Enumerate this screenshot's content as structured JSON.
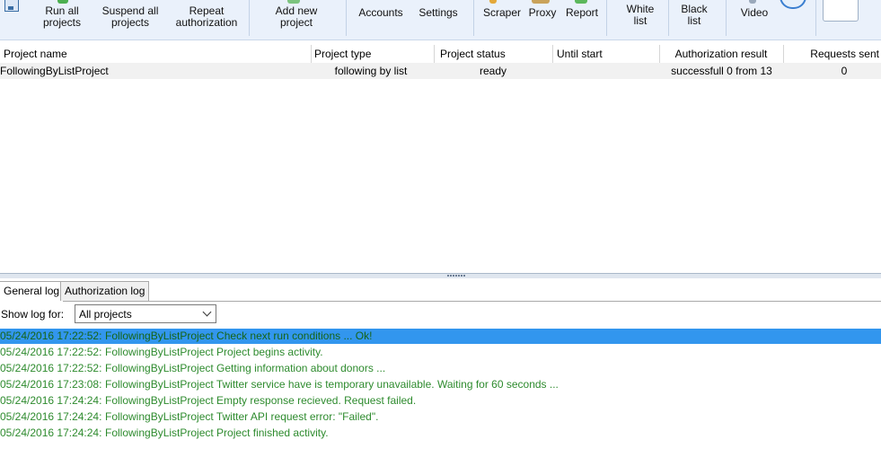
{
  "toolbar": {
    "run_all": [
      "Run all",
      "projects"
    ],
    "suspend_all": [
      "Suspend all",
      "projects"
    ],
    "repeat_auth": [
      "Repeat",
      "authorization"
    ],
    "add_project": [
      "Add new",
      "project"
    ],
    "accounts": "Accounts",
    "settings": "Settings",
    "scraper": "Scraper",
    "proxy": "Proxy",
    "report": "Report",
    "white_list": [
      "White",
      "list"
    ],
    "black_list": [
      "Black",
      "list"
    ],
    "video": "Video"
  },
  "table": {
    "headers": [
      "Project name",
      "Project type",
      "Project status",
      "Until start",
      "Authorization result",
      "Requests sent"
    ],
    "rows": [
      [
        "FollowingByListProject",
        "following by list",
        "ready",
        "",
        "successfull 0 from 13",
        "0"
      ]
    ]
  },
  "tabs": [
    "General log",
    "Authorization log"
  ],
  "filter": {
    "label": "Show log for:",
    "value": "All projects"
  },
  "log": [
    {
      "time": "05/24/2016 17:22:52:",
      "msg": "FollowingByListProject Check next run conditions ... Ok!"
    },
    {
      "time": "05/24/2016 17:22:52:",
      "msg": "FollowingByListProject Project begins activity."
    },
    {
      "time": "05/24/2016 17:22:52:",
      "msg": "FollowingByListProject Getting information about donors ..."
    },
    {
      "time": "05/24/2016 17:23:08:",
      "msg": "FollowingByListProject Twitter service have is temporary unavailable. Waiting for 60 seconds ..."
    },
    {
      "time": "05/24/2016 17:24:24:",
      "msg": "FollowingByListProject Empty response recieved. Request failed."
    },
    {
      "time": "05/24/2016 17:24:24:",
      "msg": "FollowingByListProject Twitter API request error: \"Failed\"."
    },
    {
      "time": "05/24/2016 17:24:24:",
      "msg": "FollowingByListProject Project finished activity."
    }
  ],
  "colors": {
    "toolbar_bg": "#eaf1fb",
    "selection": "#3296ee",
    "log_text": "#2e8b2e"
  }
}
